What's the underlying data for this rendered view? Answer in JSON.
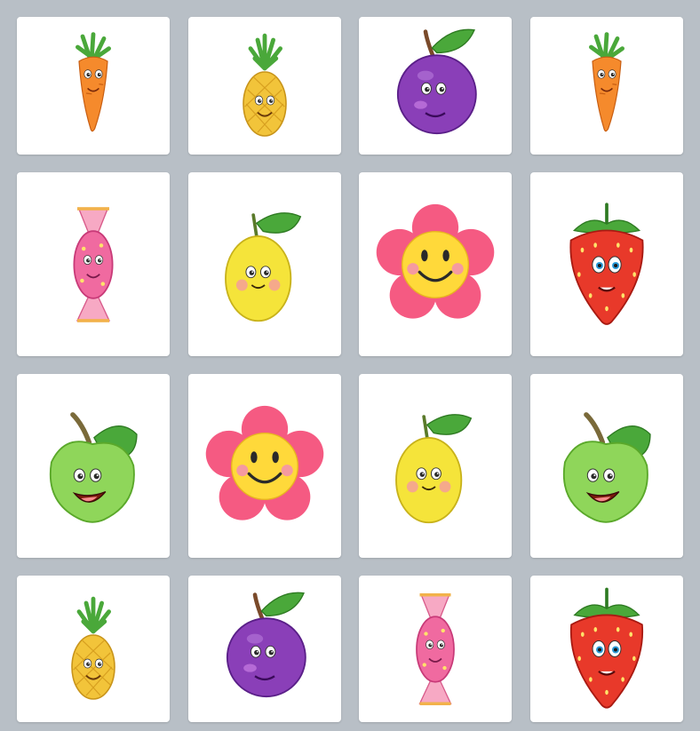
{
  "board": {
    "cards": [
      {
        "fruit": "carrot"
      },
      {
        "fruit": "pineapple"
      },
      {
        "fruit": "plum"
      },
      {
        "fruit": "carrot"
      },
      {
        "fruit": "candy"
      },
      {
        "fruit": "lemon"
      },
      {
        "fruit": "flower"
      },
      {
        "fruit": "strawberry"
      },
      {
        "fruit": "apple"
      },
      {
        "fruit": "flower"
      },
      {
        "fruit": "lemon"
      },
      {
        "fruit": "apple"
      },
      {
        "fruit": "pineapple"
      },
      {
        "fruit": "plum"
      },
      {
        "fruit": "candy"
      },
      {
        "fruit": "strawberry"
      }
    ]
  },
  "colors": {
    "background": "#b8bfc6",
    "card": "#ffffff",
    "carrot": "#f58a2c",
    "pineapple": "#f2c43a",
    "plum": "#8a3fb8",
    "candy": "#f06aa0",
    "lemon": "#f5e43a",
    "flower_petal": "#f55a82",
    "flower_center": "#ffd93a",
    "strawberry": "#e8392a",
    "apple": "#8fd65a",
    "leaf": "#4aa83a"
  }
}
